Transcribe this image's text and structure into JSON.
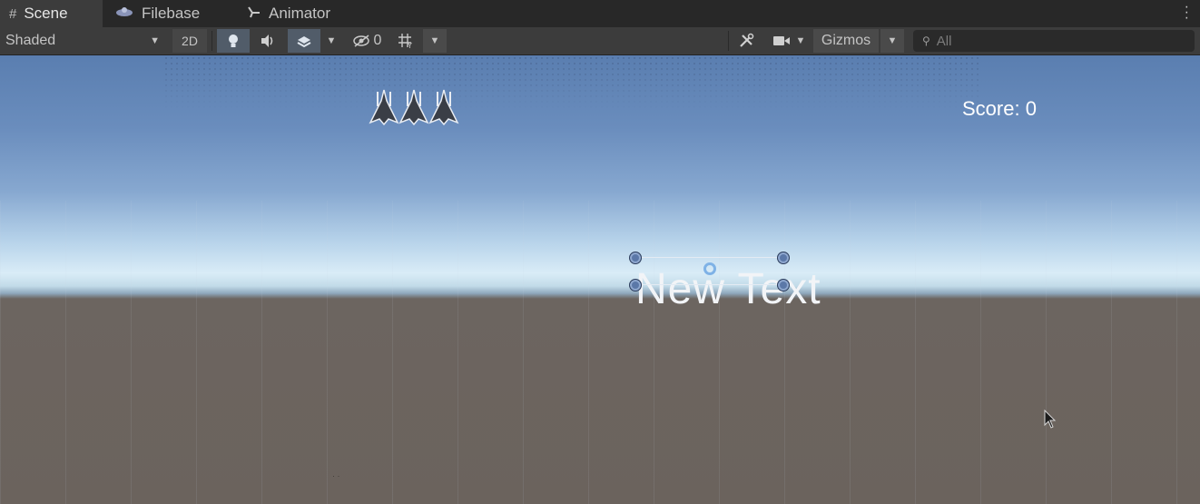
{
  "tabs": [
    {
      "label": "Scene",
      "icon": "hash-icon"
    },
    {
      "label": "Filebase",
      "icon": "filebase-icon"
    },
    {
      "label": "Animator",
      "icon": "animator-icon"
    }
  ],
  "toolbar": {
    "shading_mode": "Shaded",
    "mode_2d": "2D",
    "hidden_count": "0",
    "gizmos_label": "Gizmos",
    "search_placeholder": "All"
  },
  "scene": {
    "score_text": "Score: 0",
    "ui_text": "New Text",
    "lives_icons": [
      "ship-icon",
      "ship-icon",
      "ship-icon"
    ]
  },
  "colors": {
    "sky_top": "#5a7eb0",
    "horizon": "#d9ecf7",
    "ground": "#6b635d",
    "toolbar_bg": "#3c3c3c"
  }
}
